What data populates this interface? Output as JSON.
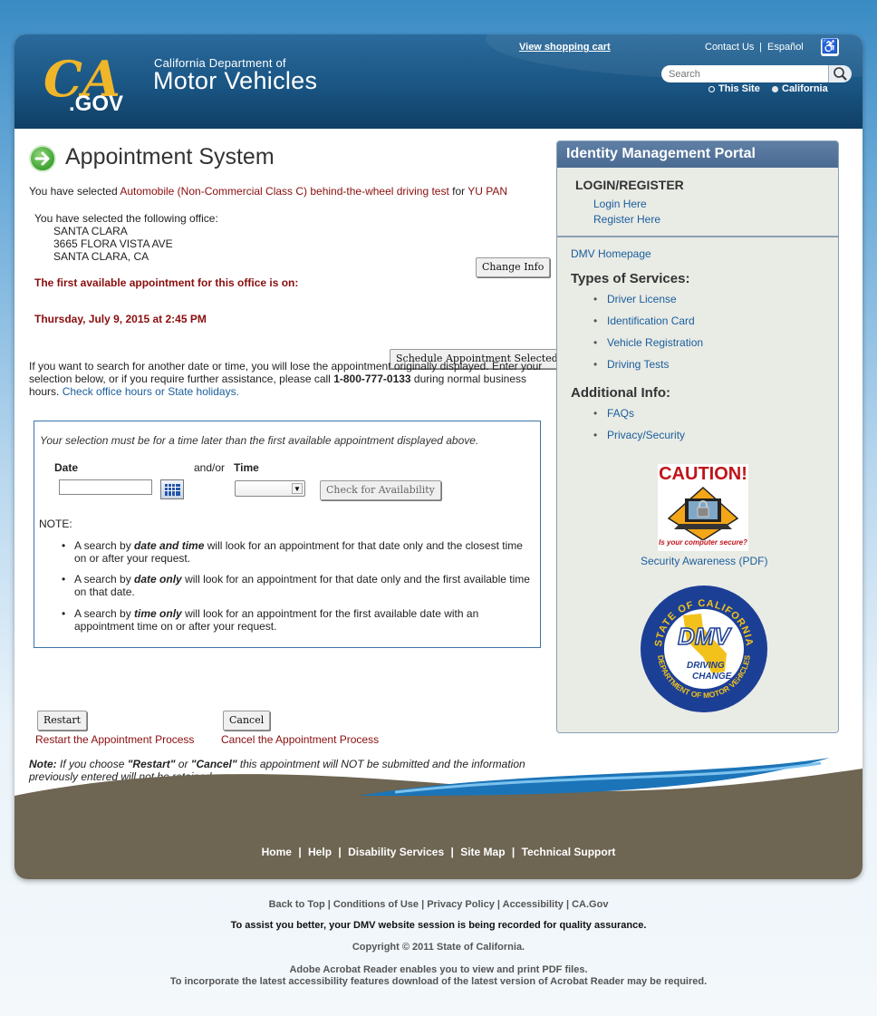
{
  "header": {
    "logo_text": "CA.GOV",
    "dept_line1": "California Department of",
    "dept_line2": "Motor Vehicles",
    "cart_link": "View shopping cart",
    "contact_link": "Contact Us",
    "sep": "|",
    "espanol_link": "Español",
    "search_placeholder": "Search",
    "radio_this_site": "This Site",
    "radio_california": "California"
  },
  "main": {
    "title": "Appointment System",
    "sel_prefix": "You have selected ",
    "sel_service": "Automobile (Non-Commercial Class C) behind-the-wheel driving test",
    "sel_for": " for ",
    "sel_name": "YU PAN",
    "office_intro": "You have selected the following office:",
    "office_name": "SANTA CLARA",
    "office_street": "3665 FLORA VISTA AVE",
    "office_city": "SANTA CLARA, CA",
    "change_info_btn": "Change Info",
    "first_avail": "The first available appointment for this office is on:",
    "first_date": "Thursday, July 9, 2015 at 2:45 PM",
    "schedule_btn": "Schedule Appointment Selected",
    "para_a": "If you want to search for another date or time, you will lose the appointment originally displayed. Enter your selection below, or if you require further assistance, please call ",
    "para_phone": "1-800-777-0133",
    "para_b": " during normal business hours. ",
    "para_link": "Check office hours or State holidays."
  },
  "selection": {
    "instruction": "Your selection must be for a time later than the first available appointment displayed above.",
    "date_label": "Date",
    "andor": "and/or",
    "time_label": "Time",
    "check_btn": "Check for Availability",
    "note_label": "NOTE:",
    "b1_pre": "A search by ",
    "b1_em": "date and time",
    "b1_post": " will look for an appointment for that date only and the closest time on or after your request.",
    "b2_pre": "A search by ",
    "b2_em": "date only",
    "b2_post": " will look for an appointment for that date only and the first available time on that date.",
    "b3_pre": "A search by ",
    "b3_em": "time only",
    "b3_post": " will look for an appointment for the first available date with an appointment time on or after your request."
  },
  "actions": {
    "restart_btn": "Restart",
    "restart_label": "Restart the Appointment Process",
    "cancel_btn": "Cancel",
    "cancel_label": "Cancel the Appointment Process",
    "note_bold": "Note:",
    "note_a": " If you choose ",
    "note_restart": "\"Restart\"",
    "note_or": " or ",
    "note_cancel": "\"Cancel\"",
    "note_b": " this appointment will NOT be submitted and the information previously entered will not be retained."
  },
  "sidebar": {
    "header": "Identity Management Portal",
    "login_title": "LOGIN/REGISTER",
    "login_here": "Login Here",
    "register_here": "Register Here",
    "dmv_home": "DMV Homepage",
    "types_title": "Types of Services:",
    "services": [
      "Driver License",
      "Identification Card",
      "Vehicle Registration",
      "Driving Tests"
    ],
    "additional_title": "Additional Info:",
    "additional": [
      "FAQs",
      "Privacy/Security"
    ],
    "caution_title": "CAUTION!",
    "caution_sub": "Is your computer secure?",
    "security_link": "Security Awareness (PDF)",
    "seal_top": "STATE OF CALIFORNIA",
    "seal_bottom": "DEPARTMENT OF MOTOR VEHICLES",
    "seal_dmv": "DMV",
    "seal_tag1": "DRIVING",
    "seal_tag2": "CHANGE..."
  },
  "footer": {
    "links": [
      "Home",
      "Help",
      "Disability Services",
      "Site Map",
      "Technical Support"
    ],
    "sub_links": [
      "Back to Top",
      "Conditions of Use",
      "Privacy Policy",
      "Accessibility",
      "CA.Gov"
    ],
    "session_note": "To assist you better, your DMV website session is being recorded for quality assurance.",
    "copyright": "Copyright © 2011 State of California.",
    "acrobat1": "Adobe Acrobat Reader  enables you to view and print PDF files.",
    "acrobat2": "To incorporate the latest accessibility features download of the latest version of Acrobat Reader may be required."
  },
  "colors": {
    "header_blue": "#1a5583",
    "accent_red": "#8a0d0d",
    "link_blue": "#1a5e9c",
    "footer_brown": "#6e6552"
  }
}
